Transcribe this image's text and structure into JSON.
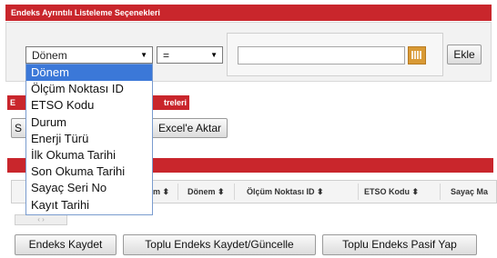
{
  "panel": {
    "title": "Endeks Ayrıntılı Listeleme Seçenekleri"
  },
  "filter": {
    "field_select_value": "Dönem",
    "operator_select_value": "=",
    "value_input": "",
    "add_button": "Ekle"
  },
  "section2": {
    "title_left": "E",
    "title_right": "treleri"
  },
  "toolbar2": {
    "button_left": "S",
    "export_button": "Excel'e Aktar"
  },
  "table": {
    "headers": [
      {
        "label": "m ⬍",
        "name": "column-header-partial"
      },
      {
        "label": "Dönem ⬍",
        "name": "column-header-donem"
      },
      {
        "label": "Ölçüm Noktası ID ⬍",
        "name": "column-header-olcum-noktasi-id"
      },
      {
        "label": "ETSO Kodu ⬍",
        "name": "column-header-etso-kodu"
      },
      {
        "label": "Sayaç Ma",
        "name": "column-header-sayac-ma"
      }
    ],
    "pager": "‹ ›"
  },
  "dropdown": {
    "options": [
      "Dönem",
      "Ölçüm Noktası ID",
      "ETSO Kodu",
      "Durum",
      "Enerji Türü",
      "İlk Okuma Tarihi",
      "Son Okuma Tarihi",
      "Sayaç Seri No",
      "Kayıt Tarihi"
    ],
    "selected_index": 0
  },
  "actions": {
    "save": "Endeks Kaydet",
    "bulk_save": "Toplu Endeks Kaydet/Güncelle",
    "bulk_passive": "Toplu Endeks Pasif Yap"
  },
  "colors": {
    "header_red": "#c9262c",
    "selection_blue": "#3b78d8",
    "calendar_orange": "#d99a35"
  },
  "icons": {
    "calendar": "calendar-icon",
    "dropdown": "chevron-down-icon"
  }
}
